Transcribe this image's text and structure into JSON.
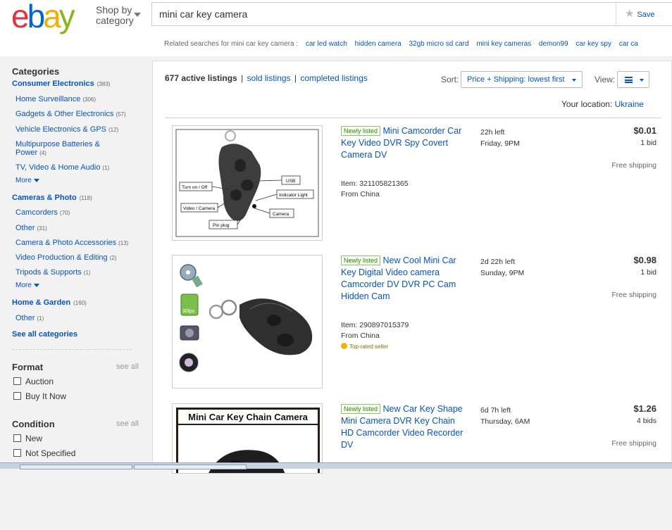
{
  "header": {
    "logo": {
      "letters": [
        "e",
        "b",
        "a",
        "y"
      ],
      "colors": [
        "#e53238",
        "#0064d2",
        "#f5af02",
        "#86b817"
      ]
    },
    "shop_by": {
      "line1": "Shop by",
      "line2": "category"
    },
    "search": {
      "value": "mini car key camera"
    },
    "save_label": "Save",
    "related": {
      "label": "Related searches for mini car key camera :",
      "links": [
        "car led watch",
        "hidden camera",
        "32gb micro sd card",
        "mini key cameras",
        "demon99",
        "car key spy",
        "car ca"
      ]
    }
  },
  "sidebar": {
    "categories_title": "Categories",
    "groups": [
      {
        "name": "Consumer Electronics",
        "count": "(383)",
        "items": [
          {
            "label": "Home Surveillance",
            "count": "(306)"
          },
          {
            "label": "Gadgets & Other Electronics",
            "count": "(57)"
          },
          {
            "label": "Vehicle Electronics & GPS",
            "count": "(12)"
          },
          {
            "label": "Multipurpose Batteries & Power",
            "count": "(4)"
          },
          {
            "label": "TV, Video & Home Audio",
            "count": "(1)"
          }
        ],
        "more": "More"
      },
      {
        "name": "Cameras & Photo",
        "count": "(118)",
        "items": [
          {
            "label": "Camcorders",
            "count": "(70)"
          },
          {
            "label": "Other",
            "count": "(31)"
          },
          {
            "label": "Camera & Photo Accessories",
            "count": "(13)"
          },
          {
            "label": "Video Production & Editing",
            "count": "(2)"
          },
          {
            "label": "Tripods & Supports",
            "count": "(1)"
          }
        ],
        "more": "More"
      },
      {
        "name": "Home & Garden",
        "count": "(160)",
        "items": [
          {
            "label": "Other",
            "count": "(1)"
          }
        ]
      }
    ],
    "see_all_categories": "See all categories",
    "format": {
      "title": "Format",
      "see_all": "see all",
      "options": [
        "Auction",
        "Buy It Now"
      ]
    },
    "condition": {
      "title": "Condition",
      "see_all": "see all",
      "options": [
        "New",
        "Not Specified"
      ]
    }
  },
  "results": {
    "active": "677 active listings",
    "sold": "sold listings",
    "completed": "completed listings",
    "sort_label": "Sort:",
    "sort_value": "Price + Shipping: lowest first",
    "view_label": "View:",
    "location_label": "Your location:",
    "location_value": "Ukraine"
  },
  "listings": [
    {
      "badge": "Newly listed",
      "title": "Mini Camcorder Car Key Video DVR Spy Covert Camera DV",
      "item_no": "Item: 321105821365",
      "origin": "From China",
      "time_left": "22h left",
      "end_time": "Friday, 9PM",
      "price": "$0.01",
      "bids": "1 bid",
      "shipping": "Free shipping",
      "thumb_labels": [
        "Turn on / Off",
        "USB",
        "Indicator Light",
        "Video / Camera",
        "Camera",
        "Pin plug"
      ]
    },
    {
      "badge": "Newly listed",
      "title": "New Cool Mini Car Key Digital Video camera Camcorder DV DVR PC Cam Hidden Cam",
      "item_no": "Item: 290897015379",
      "origin": "From China",
      "top_rated": "Top-rated seller",
      "time_left": "2d 22h left",
      "end_time": "Sunday, 9PM",
      "price": "$0.98",
      "bids": "1 bid",
      "shipping": "Free shipping",
      "thumb_labels": [
        "30fps"
      ]
    },
    {
      "badge": "Newly listed",
      "title": "New Car Key Shape Mini Camera DVR Key Chain HD Camcorder Video Recorder DV",
      "time_left": "6d 7h left",
      "end_time": "Thursday, 6AM",
      "price": "$1.26",
      "bids": "4 bids",
      "shipping": "Free shipping",
      "thumb_labels": [
        "Mini Car Key Chain Camera"
      ]
    }
  ]
}
